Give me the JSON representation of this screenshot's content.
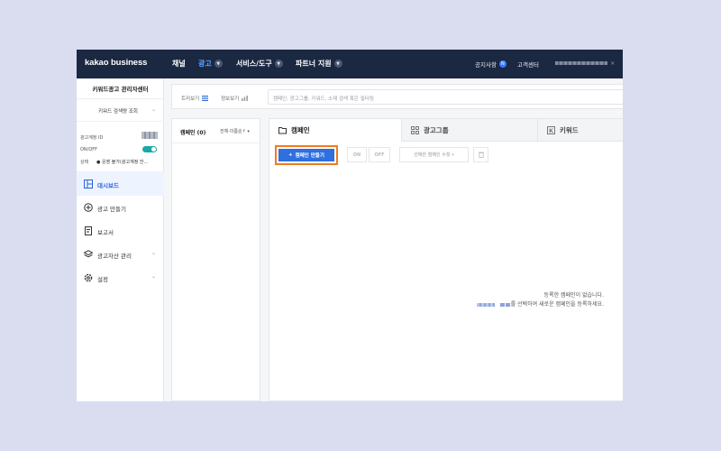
{
  "topnav": {
    "brand": "kakao business",
    "menu": [
      "채널",
      "광고",
      "서비스/도구",
      "파트너 지원"
    ],
    "notice": "공지사항",
    "notice_badge": "N",
    "support": "고객센터",
    "close": "×"
  },
  "sidebar": {
    "title": "키워드광고 관리자센터",
    "keyword_search": "키워드 검색량 조회",
    "account": {
      "id_label": "광고계정 ID",
      "onoff_label": "ON/OFF",
      "status_label": "상태",
      "status_value": "운영 불가(광고계정 잔..."
    },
    "menu": [
      {
        "label": "대시보드"
      },
      {
        "label": "광고 만들기"
      },
      {
        "label": "보고서"
      },
      {
        "label": "광고자산 관리"
      },
      {
        "label": "설정"
      }
    ]
  },
  "search": {
    "tree_view": "트리보기",
    "info_view": "정보보기",
    "placeholder": "캠페인, 광고그룹, 키워드, 소재 검색 혹은 필터링"
  },
  "campaign_list": {
    "title": "캠페인 (0)",
    "filter": "전체·이름순↑"
  },
  "tabs": [
    "캠페인",
    "광고그룹",
    "키워드"
  ],
  "toolbar": {
    "create": "캠페인 만들기",
    "on": "ON",
    "off": "OFF",
    "edit": "선택한 캠페인 수정"
  },
  "empty": {
    "line1": "등록한 캠페인이 없습니다.",
    "line2": "를 선택하여 새로운 캠페인을 등록하세요."
  },
  "colors": {
    "nav_bg": "#1b2842",
    "accent": "#2f6fe0",
    "highlight": "#f07b1f",
    "toggle": "#1aa7a8"
  }
}
